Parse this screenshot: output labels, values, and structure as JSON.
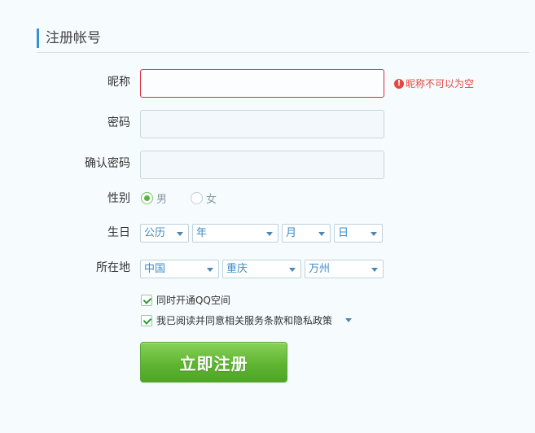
{
  "header": {
    "title": "注册帐号"
  },
  "form": {
    "nickname": {
      "label": "昵称",
      "value": "",
      "error": "昵称不可以为空",
      "error_icon": "!"
    },
    "password": {
      "label": "密码",
      "value": ""
    },
    "confirm_password": {
      "label": "确认密码",
      "value": ""
    },
    "gender": {
      "label": "性别",
      "options": [
        "男",
        "女"
      ],
      "selected": "男"
    },
    "birthday": {
      "label": "生日",
      "calendar": "公历",
      "year": "年",
      "month": "月",
      "day": "日"
    },
    "location": {
      "label": "所在地",
      "country": "中国",
      "province": "重庆",
      "city": "万州"
    },
    "options": [
      {
        "label": "同时开通QQ空间",
        "checked": true
      },
      {
        "label": "我已阅读并同意相关服务条款和隐私政策",
        "checked": true
      }
    ],
    "submit_label": "立即注册"
  },
  "colors": {
    "accent": "#3a8ed8",
    "error": "#e5483f",
    "submit_green": "#5fb531"
  }
}
